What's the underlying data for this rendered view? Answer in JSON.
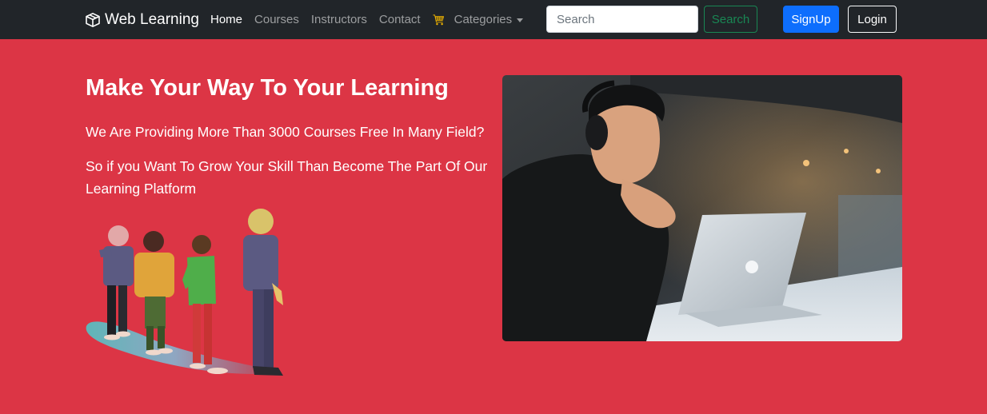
{
  "navbar": {
    "brand": "Web Learning",
    "links": [
      {
        "label": "Home",
        "active": true
      },
      {
        "label": "Courses",
        "active": false
      },
      {
        "label": "Instructors",
        "active": false
      },
      {
        "label": "Contact",
        "active": false
      }
    ],
    "cart_icon": "cart-icon",
    "categories_label": "Categories",
    "search_placeholder": "Search",
    "search_button": "Search",
    "signup_button": "SignUp",
    "login_button": "Login"
  },
  "hero": {
    "title": "Make Your Way To Your Learning",
    "subtitle": "We Are Providing More Than 3000 Courses Free In Many Field?",
    "description": "So if you Want To Grow Your Skill Than Become The Part Of Our Learning Platform"
  },
  "colors": {
    "navbar_bg": "#212529",
    "hero_bg": "#dc3545",
    "signup": "#0d6efd",
    "search_outline": "#198754"
  }
}
